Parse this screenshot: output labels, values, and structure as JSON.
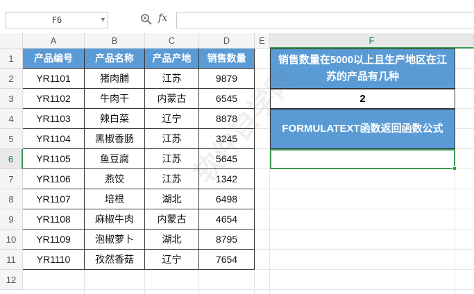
{
  "formula_bar": {
    "name_box": "F6",
    "fx_label": "fx",
    "formula_value": ""
  },
  "columns": [
    "A",
    "B",
    "C",
    "D",
    "E",
    "F"
  ],
  "rows": [
    "1",
    "2",
    "3",
    "4",
    "5",
    "6",
    "7",
    "8",
    "9",
    "10",
    "11",
    "12"
  ],
  "table": {
    "headers": [
      "产品编号",
      "产品名称",
      "产品产地",
      "销售数量"
    ],
    "rows": [
      [
        "YR1101",
        "猪肉脯",
        "江苏",
        "9879"
      ],
      [
        "YR1102",
        "牛肉干",
        "内蒙古",
        "6545"
      ],
      [
        "YR1103",
        "辣白菜",
        "辽宁",
        "8878"
      ],
      [
        "YR1104",
        "黑椒香肠",
        "江苏",
        "3245"
      ],
      [
        "YR1105",
        "鱼豆腐",
        "江苏",
        "5645"
      ],
      [
        "YR1106",
        "燕饺",
        "江苏",
        "1342"
      ],
      [
        "YR1107",
        "培根",
        "湖北",
        "6498"
      ],
      [
        "YR1108",
        "麻椒牛肉",
        "内蒙古",
        "4654"
      ],
      [
        "YR1109",
        "泡椒萝卜",
        "湖北",
        "8795"
      ],
      [
        "YR1110",
        "孜然香菇",
        "辽宁",
        "7654"
      ]
    ]
  },
  "side_panel": {
    "question": "销售数量在5000以上且生产地区在江苏的产品有几种",
    "answer": "2",
    "formula_title": "FORMULATEXT函数返回函数公式",
    "formula_result": ""
  },
  "colors": {
    "header_blue": "#5b9bd5",
    "selection_green": "#3a9a4e"
  }
}
